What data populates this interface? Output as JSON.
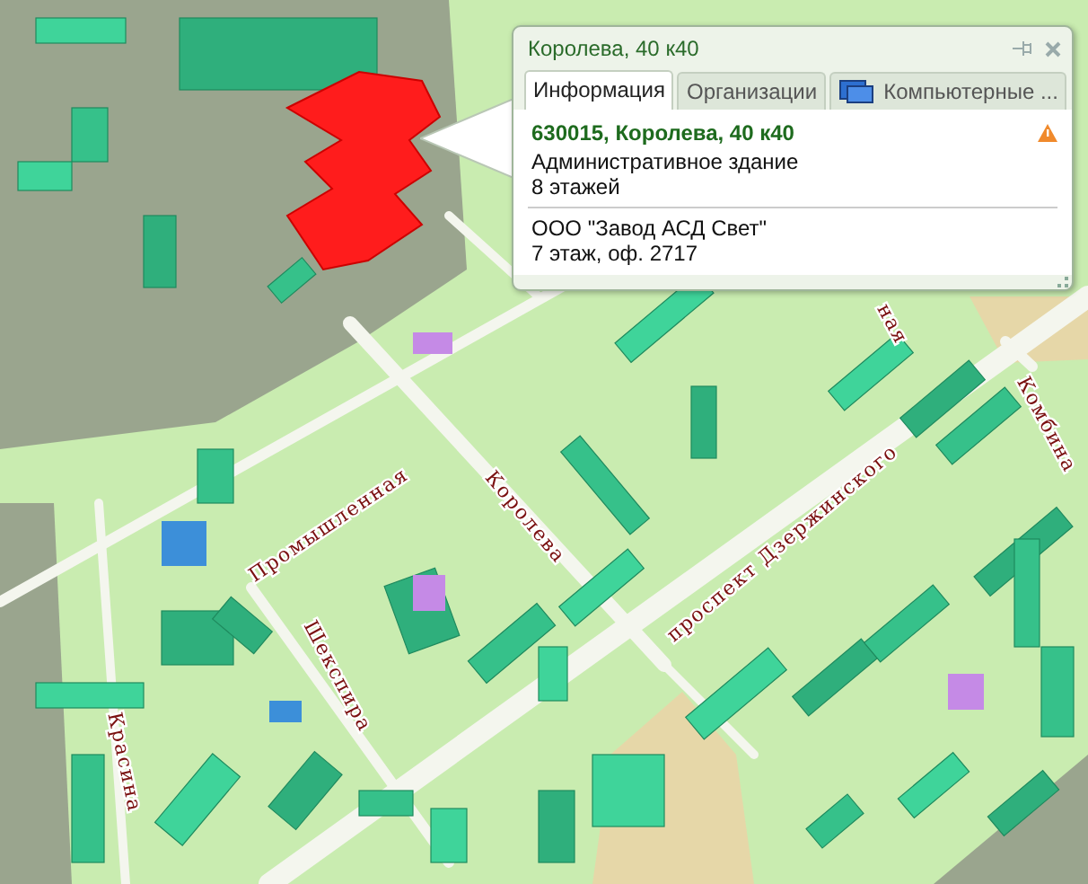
{
  "map": {
    "street_labels": [
      "Промышленная",
      "Королева",
      "проспект Дзержинского",
      "Шекспира",
      "Красина",
      "Комбина",
      "ная"
    ]
  },
  "popup": {
    "title": "Королева, 40 к40",
    "tabs": [
      {
        "label": "Информация",
        "selected": true,
        "kind": "plain"
      },
      {
        "label": "Организации",
        "selected": false,
        "kind": "plain"
      },
      {
        "label": "Компьютерные ...",
        "selected": false,
        "kind": "icon"
      }
    ],
    "address": "630015, Королева, 40 к40",
    "building_lines": [
      "Административное здание",
      "8 этажей"
    ],
    "organization_lines": [
      "ООО \"Завод АСД Свет\"",
      "7 этаж, оф. 2717"
    ]
  }
}
